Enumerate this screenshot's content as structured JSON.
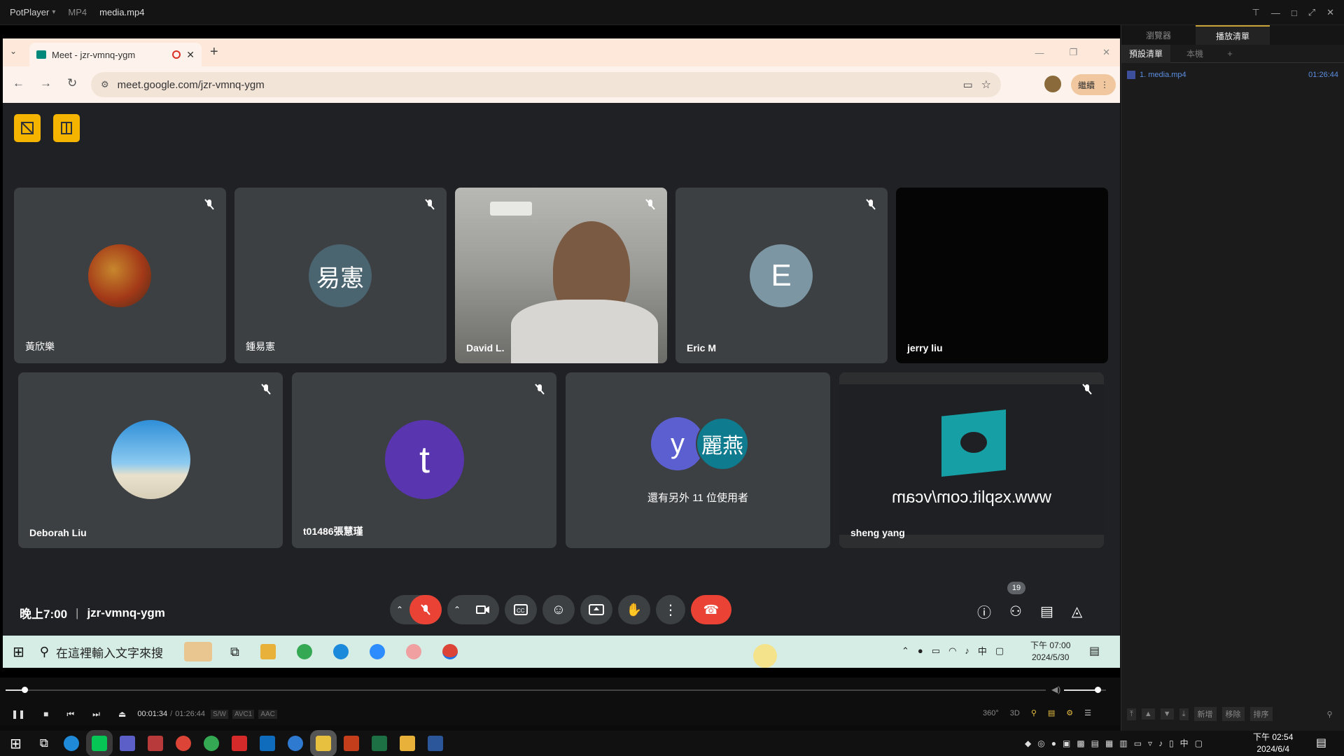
{
  "potplayer": {
    "app": "PotPlayer",
    "format": "MP4",
    "file": "media.mp4"
  },
  "browser": {
    "tab_title": "Meet - jzr-vmnq-ygm",
    "url": "meet.google.com/jzr-vmnq-ygm",
    "profile_btn": "繼續"
  },
  "meet": {
    "tiles": [
      {
        "name": "黃欣樂"
      },
      {
        "name": "鍾易憲",
        "initials": "易憲"
      },
      {
        "name": "David L."
      },
      {
        "name": "Eric M",
        "initials": "E"
      },
      {
        "name": "jerry liu"
      },
      {
        "name": "Deborah Liu"
      },
      {
        "name": "t01486張慧瑾",
        "initials": "t"
      },
      {
        "others_text": "還有另外 11 位使用者",
        "initial_y": "y",
        "initial_b": "麗燕"
      },
      {
        "name": "sheng yang",
        "cam_text": "www.xsplit.com/vcam"
      }
    ],
    "time": "晚上7:00",
    "meeting_code": "jzr-vmnq-ygm",
    "people_count": "19"
  },
  "inner_taskbar": {
    "search_placeholder": "在這裡輸入文字來搜",
    "time": "下午 07:00",
    "date": "2024/5/30",
    "ime": "中"
  },
  "playlist": {
    "tabs": [
      "瀏覽器",
      "播放清單"
    ],
    "subtabs": [
      "預設清單",
      "本機",
      "+"
    ],
    "items": [
      {
        "title": "1. media.mp4",
        "duration": "01:26:44"
      }
    ],
    "buttons": [
      "新增",
      "移除",
      "排序"
    ]
  },
  "player": {
    "current": "00:01:34",
    "total": "01:26:44",
    "tags": [
      "S/W",
      "AVC1",
      "AAC"
    ],
    "right_labels": [
      "360°",
      "3D"
    ],
    "progress": 0.018,
    "volume": 0.8
  },
  "taskbar": {
    "time": "下午 02:54",
    "date": "2024/6/4",
    "ime": "中"
  },
  "colors": {
    "meet_bg": "#202124",
    "tile_bg": "#3c4043",
    "end_call": "#ea4335",
    "yellow": "#f4b400"
  }
}
